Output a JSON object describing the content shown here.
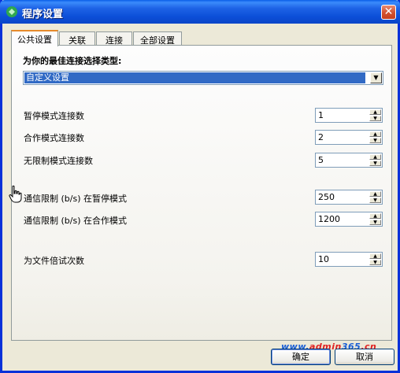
{
  "window": {
    "title": "程序设置",
    "close_glyph": "✕"
  },
  "tabs": [
    {
      "label": "公共设置",
      "active": true
    },
    {
      "label": "关联",
      "active": false
    },
    {
      "label": "连接",
      "active": false
    },
    {
      "label": "全部设置",
      "active": false
    }
  ],
  "connection": {
    "heading": "为你的最佳连接选择类型:",
    "type_selected": "自定义设置"
  },
  "fields": [
    {
      "label": "暂停模式连接数",
      "value": "1"
    },
    {
      "label": "合作模式连接数",
      "value": "2"
    },
    {
      "label": "无限制模式连接数",
      "value": "5"
    },
    {
      "label": "通信限制 (b/s) 在暂停模式",
      "value": "250"
    },
    {
      "label": "通信限制 (b/s) 在合作模式",
      "value": "1200"
    },
    {
      "label": "为文件倍试次数",
      "value": "10"
    }
  ],
  "buttons": {
    "ok": "确定",
    "cancel": "取消"
  },
  "watermark": {
    "part1": "www.",
    "part2": "admin",
    "part3": "365",
    "part4": ".cn"
  },
  "colors": {
    "titlebar": "#0c4fd8",
    "close": "#d2512f",
    "selection": "#316ac5",
    "active_tab_accent": "#e68b2c"
  },
  "icons": [
    "app-icon",
    "close-icon",
    "chevron-down-icon",
    "spin-up-icon",
    "spin-down-icon",
    "hand-cursor-icon"
  ]
}
